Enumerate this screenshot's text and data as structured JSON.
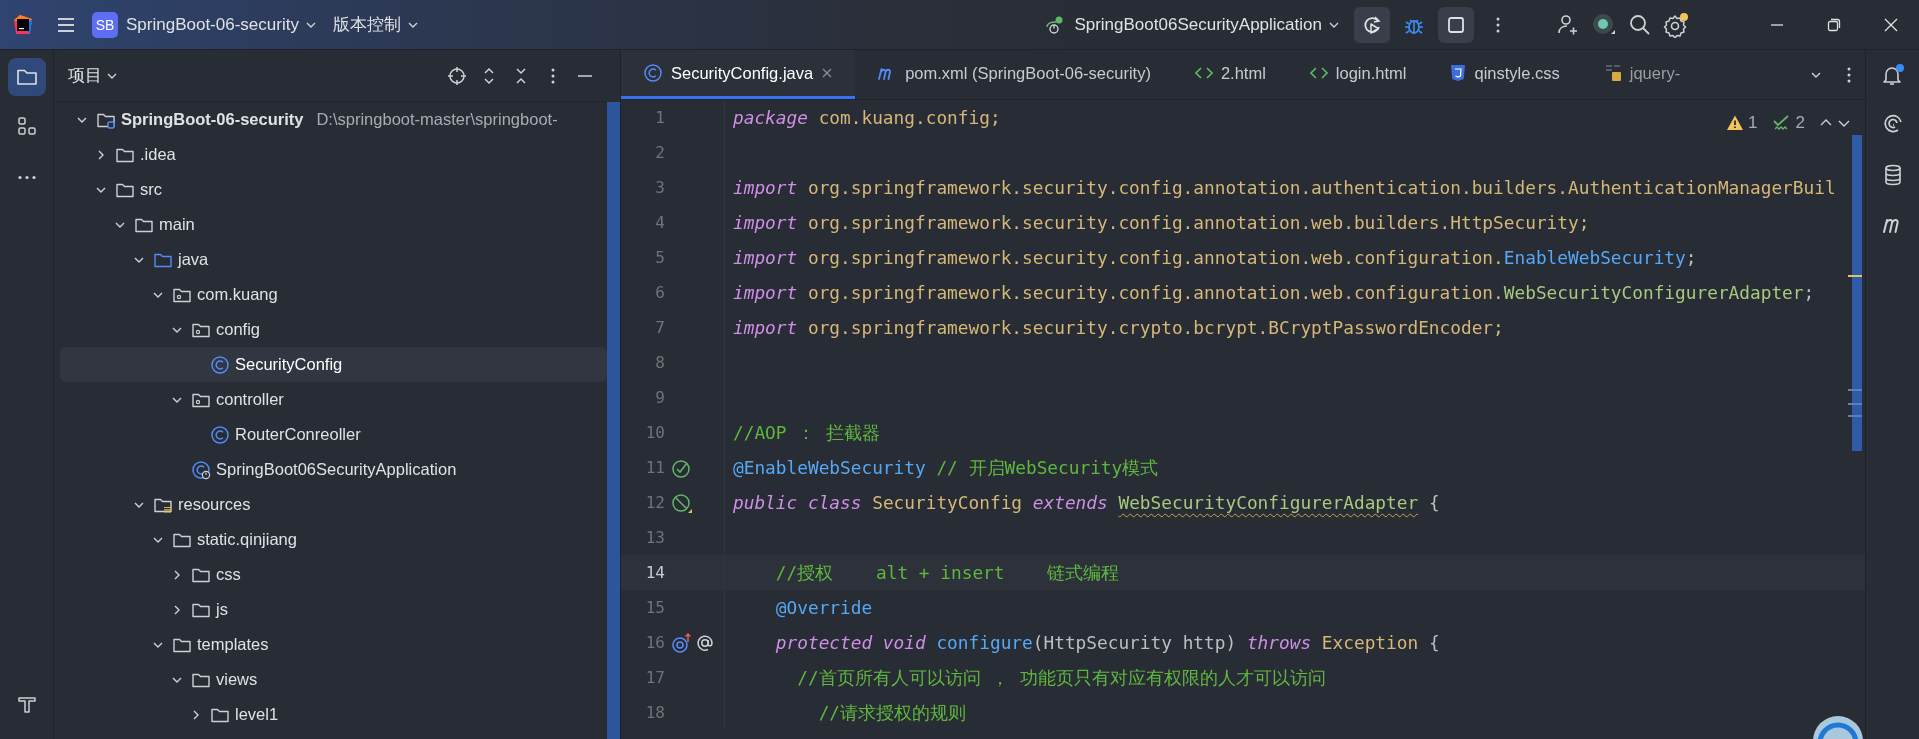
{
  "title_bar": {
    "project_badge": "SB",
    "project_name": "SpringBoot-06-security",
    "vcs": "版本控制",
    "run_config": "SpringBoot06SecurityApplication",
    "settings_badge": true
  },
  "left_toolbar": [
    {
      "kind": "project",
      "selected": true
    },
    {
      "kind": "structure",
      "selected": false
    },
    {
      "kind": "more",
      "selected": false
    }
  ],
  "left_toolbar_bottom": [
    {
      "kind": "build",
      "selected": false
    }
  ],
  "project_panel": {
    "title": "项目",
    "tree": [
      {
        "label": "SpringBoot-06-security",
        "kind": "module",
        "path": "D:\\springboot-master\\springboot-",
        "expanded": true,
        "selected": false,
        "children": [
          {
            "label": ".idea",
            "kind": "folder",
            "expanded": false,
            "selected": false
          },
          {
            "label": "src",
            "kind": "folder",
            "expanded": true,
            "selected": false,
            "children": [
              {
                "label": "main",
                "kind": "folder",
                "expanded": true,
                "selected": false,
                "children": [
                  {
                    "label": "java",
                    "kind": "source-folder",
                    "expanded": true,
                    "selected": false,
                    "children": [
                      {
                        "label": "com.kuang",
                        "kind": "package",
                        "expanded": true,
                        "selected": false,
                        "children": [
                          {
                            "label": "config",
                            "kind": "package",
                            "expanded": true,
                            "selected": false,
                            "children": [
                              {
                                "label": "SecurityConfig",
                                "kind": "class",
                                "selected": true
                              }
                            ]
                          },
                          {
                            "label": "controller",
                            "kind": "package",
                            "expanded": true,
                            "selected": false,
                            "children": [
                              {
                                "label": "RouterConreoller",
                                "kind": "class",
                                "selected": false
                              }
                            ]
                          },
                          {
                            "label": "SpringBoot06SecurityApplication",
                            "kind": "app-class",
                            "selected": false
                          }
                        ]
                      }
                    ]
                  },
                  {
                    "label": "resources",
                    "kind": "resource-folder",
                    "expanded": true,
                    "selected": false,
                    "children": [
                      {
                        "label": "static.qinjiang",
                        "kind": "folder",
                        "expanded": true,
                        "selected": false,
                        "children": [
                          {
                            "label": "css",
                            "kind": "folder",
                            "expanded": false,
                            "selected": false
                          },
                          {
                            "label": "js",
                            "kind": "folder",
                            "expanded": false,
                            "selected": false
                          }
                        ]
                      },
                      {
                        "label": "templates",
                        "kind": "folder",
                        "expanded": true,
                        "selected": false,
                        "children": [
                          {
                            "label": "views",
                            "kind": "folder",
                            "expanded": true,
                            "selected": false,
                            "children": [
                              {
                                "label": "level1",
                                "kind": "folder",
                                "expanded": false,
                                "selected": false
                              }
                            ]
                          }
                        ]
                      }
                    ]
                  }
                ]
              }
            ]
          }
        ]
      }
    ]
  },
  "tabs": [
    {
      "label": "SecurityConfig.java",
      "kind": "class",
      "selected": true
    },
    {
      "label": "pom.xml (SpringBoot-06-security)",
      "kind": "maven",
      "selected": false
    },
    {
      "label": "2.html",
      "kind": "html",
      "selected": false
    },
    {
      "label": "login.html",
      "kind": "html",
      "selected": false
    },
    {
      "label": "qinstyle.css",
      "kind": "css",
      "selected": false
    },
    {
      "label": "jquery-",
      "kind": "js",
      "selected": false
    }
  ],
  "inspections": {
    "warnings": "1",
    "weak_warnings": "2"
  },
  "right_toolbar": [
    {
      "kind": "notifications",
      "unread": true
    },
    {
      "kind": "ai",
      "unread": false
    },
    {
      "kind": "database",
      "unread": false
    },
    {
      "kind": "maven",
      "unread": false
    }
  ],
  "editor": {
    "lines": [
      {
        "number": "1",
        "current": false,
        "tokens": [
          {
            "text": "package",
            "kind": "keyword"
          },
          {
            "text": " com.kuang.config;",
            "kind": "type"
          }
        ]
      },
      {
        "number": "2",
        "current": false
      },
      {
        "number": "3",
        "current": false,
        "tokens": [
          {
            "text": "import",
            "kind": "keyword"
          },
          {
            "text": " org.springframework.security.config.annotation.authentication.builders.AuthenticationManagerBuil",
            "kind": "type"
          }
        ]
      },
      {
        "number": "4",
        "current": false,
        "tokens": [
          {
            "text": "import",
            "kind": "keyword"
          },
          {
            "text": " org.springframework.security.config.annotation.web.builders.HttpSecurity;",
            "kind": "type"
          }
        ]
      },
      {
        "number": "5",
        "current": false,
        "tokens": [
          {
            "text": "import",
            "kind": "keyword"
          },
          {
            "text": " org.springframework.security.config.annotation.web.configuration.",
            "kind": "type"
          },
          {
            "text": "EnableWebSecurity",
            "kind": "reference"
          },
          {
            "text": ";",
            "kind": "plain"
          }
        ]
      },
      {
        "number": "6",
        "current": false,
        "tokens": [
          {
            "text": "import",
            "kind": "keyword"
          },
          {
            "text": " org.springframework.security.config.annotation.web.configuration.",
            "kind": "type"
          },
          {
            "text": "WebSecurityConfigurerAdapter",
            "kind": "library"
          },
          {
            "text": ";",
            "kind": "plain"
          }
        ]
      },
      {
        "number": "7",
        "current": false,
        "tokens": [
          {
            "text": "import",
            "kind": "keyword"
          },
          {
            "text": " org.springframework.security.crypto.bcrypt.BCryptPasswordEncoder;",
            "kind": "type"
          }
        ]
      },
      {
        "number": "8",
        "current": false
      },
      {
        "number": "9",
        "current": false
      },
      {
        "number": "10",
        "current": false,
        "tokens": [
          {
            "text": "//AOP ： 拦截器",
            "kind": "comment"
          }
        ]
      },
      {
        "number": "11",
        "current": false,
        "markers": [
          {
            "kind": "bean"
          }
        ],
        "tokens": [
          {
            "text": "@EnableWebSecurity",
            "kind": "annotation"
          },
          {
            "text": " // 开启WebSecurity模式",
            "kind": "comment"
          }
        ]
      },
      {
        "number": "12",
        "current": false,
        "markers": [
          {
            "kind": "bean-class"
          }
        ],
        "tokens": [
          {
            "text": "public class",
            "kind": "keyword"
          },
          {
            "text": " SecurityConfig ",
            "kind": "type"
          },
          {
            "text": "extends ",
            "kind": "keyword"
          },
          {
            "text": "WebSecurityConfigurerAdapter",
            "kind": "library-warned"
          },
          {
            "text": " {",
            "kind": "plain"
          }
        ]
      },
      {
        "number": "13",
        "current": false
      },
      {
        "number": "14",
        "current": true,
        "tokens": [
          {
            "text": "    //授权    alt + insert    链式编程",
            "kind": "comment"
          }
        ]
      },
      {
        "number": "15",
        "current": false,
        "tokens": [
          {
            "text": "    @Override",
            "kind": "annotation"
          }
        ]
      },
      {
        "number": "16",
        "current": false,
        "markers": [
          {
            "kind": "override"
          },
          {
            "kind": "autowire"
          }
        ],
        "tokens": [
          {
            "text": "    protected void",
            "kind": "keyword"
          },
          {
            "text": " configure",
            "kind": "method"
          },
          {
            "text": "(HttpSecurity http) ",
            "kind": "plain"
          },
          {
            "text": "throws",
            "kind": "keyword"
          },
          {
            "text": " Exception",
            "kind": "type"
          },
          {
            "text": " {",
            "kind": "plain"
          }
        ]
      },
      {
        "number": "17",
        "current": false,
        "tokens": [
          {
            "text": "      //首页所有人可以访问 ， 功能页只有对应有权限的人才可以访问",
            "kind": "comment"
          }
        ]
      },
      {
        "number": "18",
        "current": false,
        "tokens": [
          {
            "text": "        //请求授权的规则",
            "kind": "comment"
          }
        ]
      }
    ]
  }
}
